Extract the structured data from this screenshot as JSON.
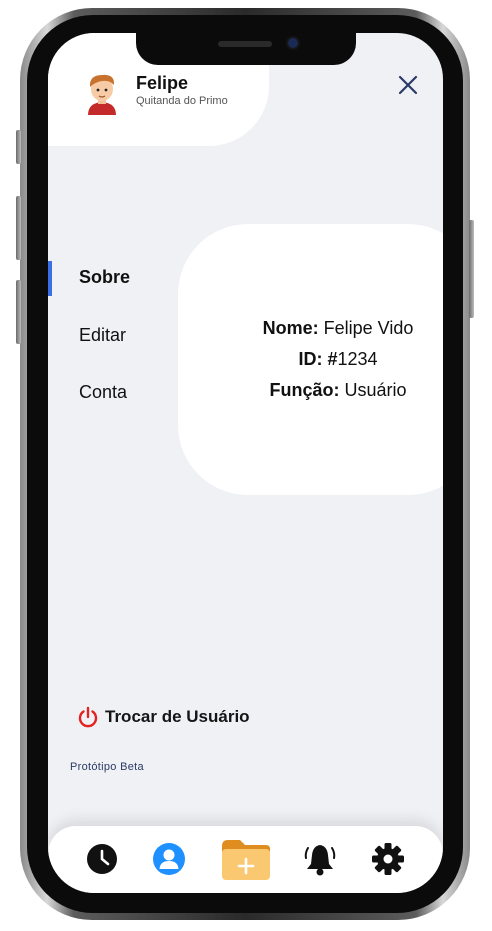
{
  "profile": {
    "name": "Felipe",
    "subtitle": "Quitanda do Primo"
  },
  "menu": {
    "items": [
      "Sobre",
      "Editar",
      "Conta"
    ],
    "active": "Sobre"
  },
  "info": {
    "name_label": "Nome:",
    "name_value": "Felipe Vido",
    "id_label": "ID: #",
    "id_value": "1234",
    "role_label": "Função:",
    "role_value": "Usuário"
  },
  "footer": {
    "switch_user": "Trocar de Usuário",
    "beta": "Protótipo Beta"
  },
  "bottom_nav": {
    "icons": [
      "clock-icon",
      "user-icon",
      "folder-add-icon",
      "bell-icon",
      "gear-icon"
    ]
  },
  "colors": {
    "accent": "#3b6fe6",
    "power": "#e32222",
    "user_icon": "#1e90ff",
    "folder": "#f7b23b",
    "background": "#f0f1f5"
  }
}
